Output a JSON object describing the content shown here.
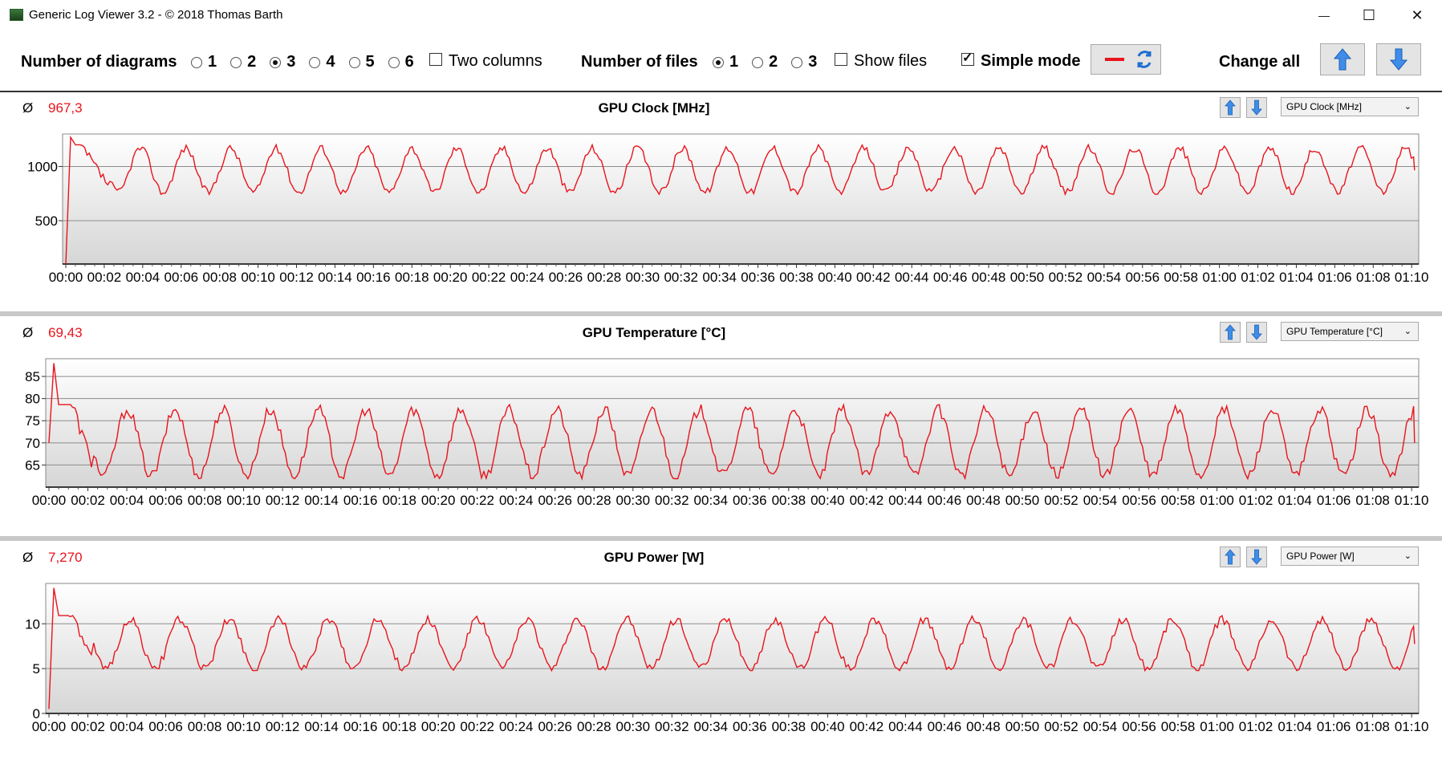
{
  "window": {
    "title": "Generic Log Viewer 3.2 - © 2018 Thomas Barth",
    "minimize": "—",
    "maximize": "☐",
    "close": "✕"
  },
  "toolbar": {
    "num_diagrams_label": "Number of diagrams",
    "diagram_options": [
      "1",
      "2",
      "3",
      "4",
      "5",
      "6"
    ],
    "diagram_selected": "3",
    "two_columns_label": "Two columns",
    "two_columns_checked": false,
    "num_files_label": "Number of files",
    "file_options": [
      "1",
      "2",
      "3"
    ],
    "file_selected": "1",
    "show_files_label": "Show files",
    "show_files_checked": false,
    "simple_mode_label": "Simple mode",
    "simple_mode_checked": true,
    "change_all_label": "Change all",
    "line_color": "#e8141c",
    "icons": [
      "line-color-icon",
      "refresh-icon",
      "arrow-up-icon",
      "arrow-down-icon"
    ]
  },
  "x_tick_labels": [
    "00:00",
    "00:02",
    "00:04",
    "00:06",
    "00:08",
    "00:10",
    "00:12",
    "00:14",
    "00:16",
    "00:18",
    "00:20",
    "00:22",
    "00:24",
    "00:26",
    "00:28",
    "00:30",
    "00:32",
    "00:34",
    "00:36",
    "00:38",
    "00:40",
    "00:42",
    "00:44",
    "00:46",
    "00:48",
    "00:50",
    "00:52",
    "00:54",
    "00:56",
    "00:58",
    "01:00",
    "01:02",
    "01:04",
    "01:06",
    "01:08",
    "01:10"
  ],
  "chart_data": [
    {
      "type": "line",
      "title": "GPU Clock [MHz]",
      "selector": "GPU Clock [MHz]",
      "average_symbol": "Ø",
      "average": "967,3",
      "yticks": [
        500,
        1000
      ],
      "ylim": [
        100,
        1300
      ],
      "xlim": [
        0,
        70.2
      ],
      "series": [
        {
          "color": "#e8141c",
          "start": [
            0,
            100
          ],
          "peak": 1270,
          "low": 760,
          "high": 1170,
          "period": 2.35,
          "base": 980
        }
      ]
    },
    {
      "type": "line",
      "title": "GPU Temperature [°C]",
      "selector": "GPU Temperature [°C]",
      "average_symbol": "Ø",
      "average": "69,43",
      "yticks": [
        65,
        70,
        75,
        80,
        85
      ],
      "ylim": [
        60,
        89
      ],
      "xlim": [
        0,
        70.2
      ],
      "series": [
        {
          "color": "#e8141c",
          "start": [
            0,
            70
          ],
          "peak": 88,
          "low": 62.5,
          "high": 77.5,
          "period": 2.45,
          "base": 69
        }
      ]
    },
    {
      "type": "line",
      "title": "GPU Power [W]",
      "selector": "GPU Power [W]",
      "average_symbol": "Ø",
      "average": "7,270",
      "yticks": [
        0,
        5,
        10
      ],
      "ylim": [
        0,
        14.5
      ],
      "xlim": [
        0,
        70.2
      ],
      "series": [
        {
          "color": "#e8141c",
          "start": [
            0,
            0.5
          ],
          "peak": 14,
          "low": 5,
          "high": 10.5,
          "period": 2.55,
          "base": 7.3
        }
      ]
    }
  ]
}
